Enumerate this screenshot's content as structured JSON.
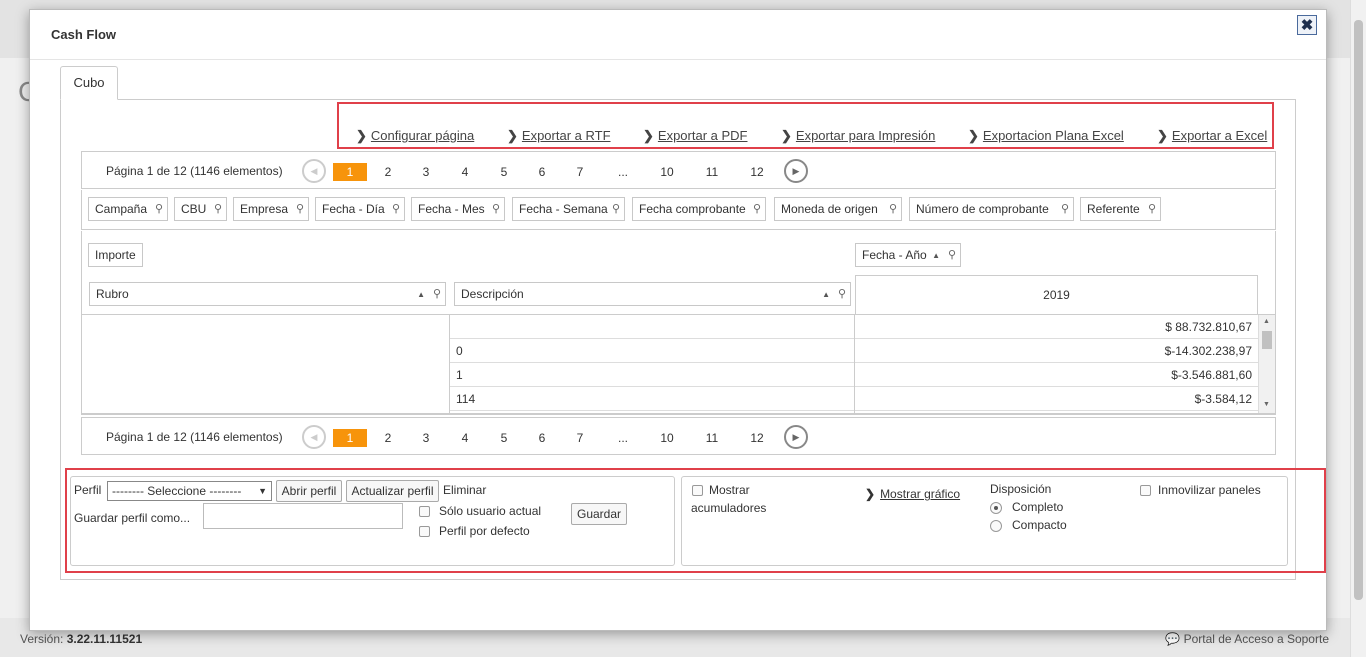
{
  "background": {
    "partial_letter": "C",
    "footer": {
      "version_label": "Versión:",
      "version_value": "3.22.11.11521",
      "support_label": "Portal de Acceso a Soporte"
    }
  },
  "modal": {
    "title": "Cash Flow",
    "close_label": "✖",
    "tab_label": "Cubo"
  },
  "export_bar": {
    "items": [
      "Configurar página",
      "Exportar a RTF",
      "Exportar a PDF",
      "Exportar para Impresión",
      "Exportacion Plana Excel",
      "Exportar a Excel"
    ]
  },
  "pager": {
    "info": "Página 1 de 12 (1146 elementos)",
    "pages": [
      "1",
      "2",
      "3",
      "4",
      "5",
      "6",
      "7",
      "...",
      "10",
      "11",
      "12"
    ],
    "active_page": "1"
  },
  "filter_fields": [
    "Campaña",
    "CBU",
    "Empresa",
    "Fecha - Día",
    "Fecha - Mes",
    "Fecha - Semana",
    "Fecha comprobante",
    "Moneda de origen",
    "Número de comprobante",
    "Referente"
  ],
  "data_field": "Importe",
  "column_field": "Fecha - Año",
  "row_fields": [
    "Rubro",
    "Descripción"
  ],
  "column_header": "2019",
  "rows": [
    {
      "rubro": "",
      "descripcion": "",
      "value": "$ 88.732.810,67"
    },
    {
      "rubro": "",
      "descripcion": "0",
      "value": "$-14.302.238,97"
    },
    {
      "rubro": "",
      "descripcion": "1",
      "value": "$-3.546.881,60"
    },
    {
      "rubro": "",
      "descripcion": "114",
      "value": "$-3.584,12"
    }
  ],
  "options": {
    "perfil_label": "Perfil",
    "perfil_select_value": "-------- Seleccione --------",
    "abrir_perfil": "Abrir perfil",
    "actualizar_perfil": "Actualizar perfil",
    "eliminar": "Eliminar",
    "guardar_como_label": "Guardar perfil como...",
    "guardar_como_value": "",
    "solo_usuario_actual": "Sólo usuario actual",
    "perfil_por_defecto": "Perfil por defecto",
    "guardar": "Guardar",
    "mostrar_acumuladores_1": "Mostrar",
    "mostrar_acumuladores_2": "acumuladores",
    "mostrar_grafico": "Mostrar gráfico",
    "disposicion_label": "Disposición",
    "completo": "Completo",
    "compacto": "Compacto",
    "inmovilizar_paneles": "Inmovilizar paneles",
    "selected_layout": "Completo"
  },
  "colors": {
    "highlight_border": "#e0404a",
    "active_page": "#f7940b"
  }
}
